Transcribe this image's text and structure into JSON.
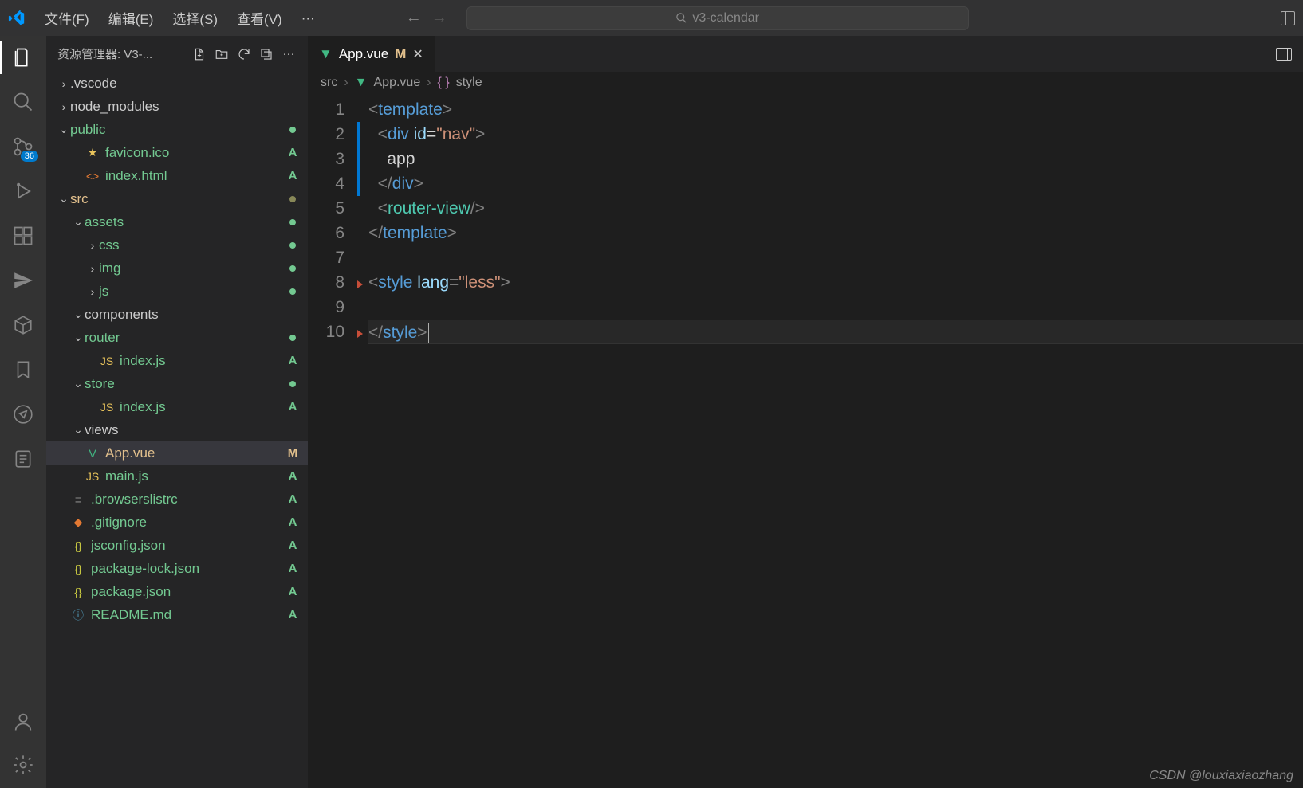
{
  "menu": {
    "file": "文件(F)",
    "edit": "编辑(E)",
    "select": "选择(S)",
    "view": "查看(V)",
    "more": "···"
  },
  "nav": {
    "back_glyph": "←",
    "fwd_glyph": "→"
  },
  "search": {
    "placeholder": "v3-calendar"
  },
  "explorer": {
    "title": "资源管理器: V3-..."
  },
  "scm_badge": "36",
  "tree": [
    {
      "depth": 0,
      "twisty": ">",
      "label": ".vscode",
      "type": "folder"
    },
    {
      "depth": 0,
      "twisty": ">",
      "label": "node_modules",
      "type": "folder"
    },
    {
      "depth": 0,
      "twisty": "v",
      "label": "public",
      "type": "folder",
      "cls": "green",
      "dot": "dot-green"
    },
    {
      "depth": 1,
      "icon": "★",
      "iconcls": "ic-yellow",
      "label": "favicon.ico",
      "status": "A",
      "cls": "green"
    },
    {
      "depth": 1,
      "icon": "<>",
      "iconcls": "ic-orange",
      "label": "index.html",
      "status": "A",
      "cls": "green"
    },
    {
      "depth": 0,
      "twisty": "v",
      "label": "src",
      "type": "folder",
      "cls": "amber",
      "dot": "dot-olive"
    },
    {
      "depth": 1,
      "twisty": "v",
      "label": "assets",
      "type": "folder",
      "cls": "green",
      "dot": "dot-green"
    },
    {
      "depth": 2,
      "twisty": ">",
      "label": "css",
      "type": "folder",
      "cls": "green",
      "dot": "dot-green"
    },
    {
      "depth": 2,
      "twisty": ">",
      "label": "img",
      "type": "folder",
      "cls": "green",
      "dot": "dot-green"
    },
    {
      "depth": 2,
      "twisty": ">",
      "label": "js",
      "type": "folder",
      "cls": "green",
      "dot": "dot-green"
    },
    {
      "depth": 1,
      "twisty": "v",
      "label": "components",
      "type": "folder"
    },
    {
      "depth": 1,
      "twisty": "v",
      "label": "router",
      "type": "folder",
      "cls": "green",
      "dot": "dot-green"
    },
    {
      "depth": 2,
      "icon": "JS",
      "iconcls": "ic-yellow",
      "label": "index.js",
      "status": "A",
      "cls": "green"
    },
    {
      "depth": 1,
      "twisty": "v",
      "label": "store",
      "type": "folder",
      "cls": "green",
      "dot": "dot-green"
    },
    {
      "depth": 2,
      "icon": "JS",
      "iconcls": "ic-yellow",
      "label": "index.js",
      "status": "A",
      "cls": "green"
    },
    {
      "depth": 1,
      "twisty": "v",
      "label": "views",
      "type": "folder"
    },
    {
      "depth": 1,
      "icon": "V",
      "iconcls": "ic-vue",
      "label": "App.vue",
      "status": "M",
      "cls": "amber",
      "selected": true
    },
    {
      "depth": 1,
      "icon": "JS",
      "iconcls": "ic-yellow",
      "label": "main.js",
      "status": "A",
      "cls": "green"
    },
    {
      "depth": 0,
      "icon": "≡",
      "iconcls": "dim",
      "label": ".browserslistrc",
      "status": "A",
      "cls": "green"
    },
    {
      "depth": 0,
      "icon": "◆",
      "iconcls": "ic-orange",
      "label": ".gitignore",
      "status": "A",
      "cls": "green"
    },
    {
      "depth": 0,
      "icon": "{}",
      "iconcls": "ic-json",
      "label": "jsconfig.json",
      "status": "A",
      "cls": "green"
    },
    {
      "depth": 0,
      "icon": "{}",
      "iconcls": "ic-json",
      "label": "package-lock.json",
      "status": "A",
      "cls": "green"
    },
    {
      "depth": 0,
      "icon": "{}",
      "iconcls": "ic-json",
      "label": "package.json",
      "status": "A",
      "cls": "green"
    },
    {
      "depth": 0,
      "icon": "ⓘ",
      "iconcls": "ic-info",
      "label": "README.md",
      "status": "A",
      "cls": "green"
    }
  ],
  "tab": {
    "name": "App.vue",
    "modified": "M"
  },
  "crumbs": {
    "a": "src",
    "b": "App.vue",
    "c": "style"
  },
  "code": [
    {
      "n": "1",
      "html": "<span class='t-gray'>&lt;</span><span class='t-blue'>template</span><span class='t-gray'>&gt;</span>"
    },
    {
      "n": "2",
      "html": "  <span class='t-gray'>&lt;</span><span class='t-blue'>div</span> <span class='t-attr'>id</span><span class='t-txt'>=</span><span class='t-str'>\"nav\"</span><span class='t-gray'>&gt;</span>"
    },
    {
      "n": "3",
      "html": "    <span class='t-txt'>app</span>"
    },
    {
      "n": "4",
      "html": "  <span class='t-gray'>&lt;/</span><span class='t-blue'>div</span><span class='t-gray'>&gt;</span>"
    },
    {
      "n": "5",
      "html": "  <span class='t-gray'>&lt;</span><span class='t-teal'>router-view</span><span class='t-gray'>/&gt;</span>"
    },
    {
      "n": "6",
      "html": "<span class='t-gray'>&lt;/</span><span class='t-blue'>template</span><span class='t-gray'>&gt;</span>"
    },
    {
      "n": "7",
      "html": ""
    },
    {
      "n": "8",
      "html": "<span class='t-gray'>&lt;</span><span class='t-blue'>style</span> <span class='t-attr'>lang</span><span class='t-txt'>=</span><span class='t-str'>\"less\"</span><span class='t-gray'>&gt;</span>"
    },
    {
      "n": "9",
      "html": ""
    },
    {
      "n": "10",
      "html": "<span class='t-gray'>&lt;/</span><span class='t-blue'>style</span><span class='t-gray'>&gt;</span><span class='cursor'></span>",
      "current": true
    }
  ],
  "watermark": "CSDN @louxiaxiaozhang"
}
